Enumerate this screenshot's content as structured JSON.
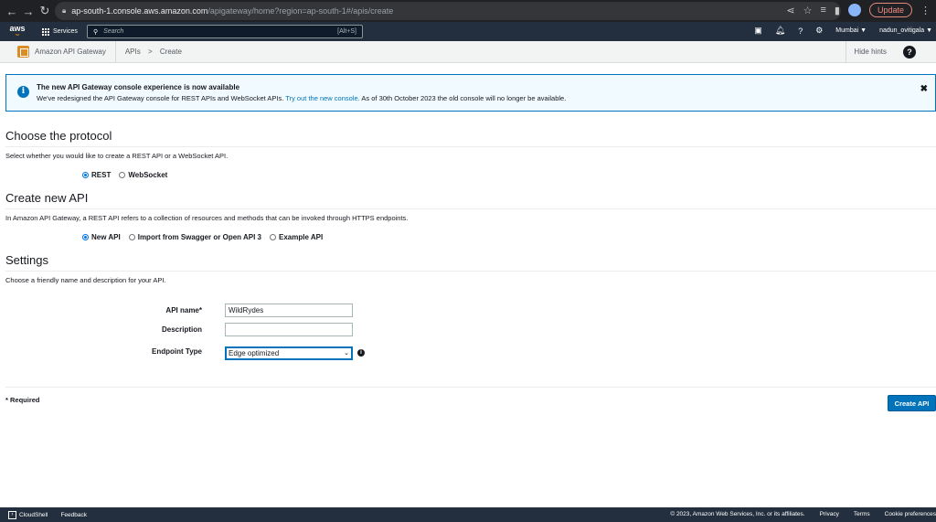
{
  "browser": {
    "url_host": "ap-south-1.console.aws.amazon.com",
    "url_path": "/apigateway/home?region=ap-south-1#/apis/create",
    "update_label": "Update"
  },
  "aws_nav": {
    "logo": "aws",
    "services_label": "Services",
    "search_placeholder": "Search",
    "search_shortcut": "[Alt+S]",
    "region": "Mumbai ▼",
    "user": "nadun_ovitigala ▼"
  },
  "breadcrumb": {
    "service_name": "Amazon API Gateway",
    "items": [
      "APIs",
      ">",
      "Create"
    ],
    "hide_hints": "Hide hints",
    "help": "?"
  },
  "banner": {
    "title": "The new API Gateway console experience is now available",
    "text_before": "We've redesigned the API Gateway console for REST APIs and WebSocket APIs.",
    "link": "Try out the new console.",
    "text_after": "As of 30th October 2023 the old console will no longer be available."
  },
  "protocol": {
    "title": "Choose the protocol",
    "desc": "Select whether you would like to create a REST API or a WebSocket API.",
    "options": [
      "REST",
      "WebSocket"
    ],
    "selected": "REST"
  },
  "create_new": {
    "title": "Create new API",
    "desc": "In Amazon API Gateway, a REST API refers to a collection of resources and methods that can be invoked through HTTPS endpoints.",
    "options": [
      "New API",
      "Import from Swagger or Open API 3",
      "Example API"
    ],
    "selected": "New API"
  },
  "settings": {
    "title": "Settings",
    "desc": "Choose a friendly name and description for your API.",
    "api_name_label": "API name*",
    "api_name_value": "WildRydes",
    "description_label": "Description",
    "description_value": "",
    "endpoint_label": "Endpoint Type",
    "endpoint_value": "Edge optimized"
  },
  "form_footer": {
    "required": "* Required",
    "create_button": "Create API"
  },
  "footer": {
    "cloudshell": "CloudShell",
    "feedback": "Feedback",
    "copyright": "© 2023, Amazon Web Services, Inc. or its affiliates.",
    "privacy": "Privacy",
    "terms": "Terms",
    "cookie": "Cookie preferences"
  }
}
